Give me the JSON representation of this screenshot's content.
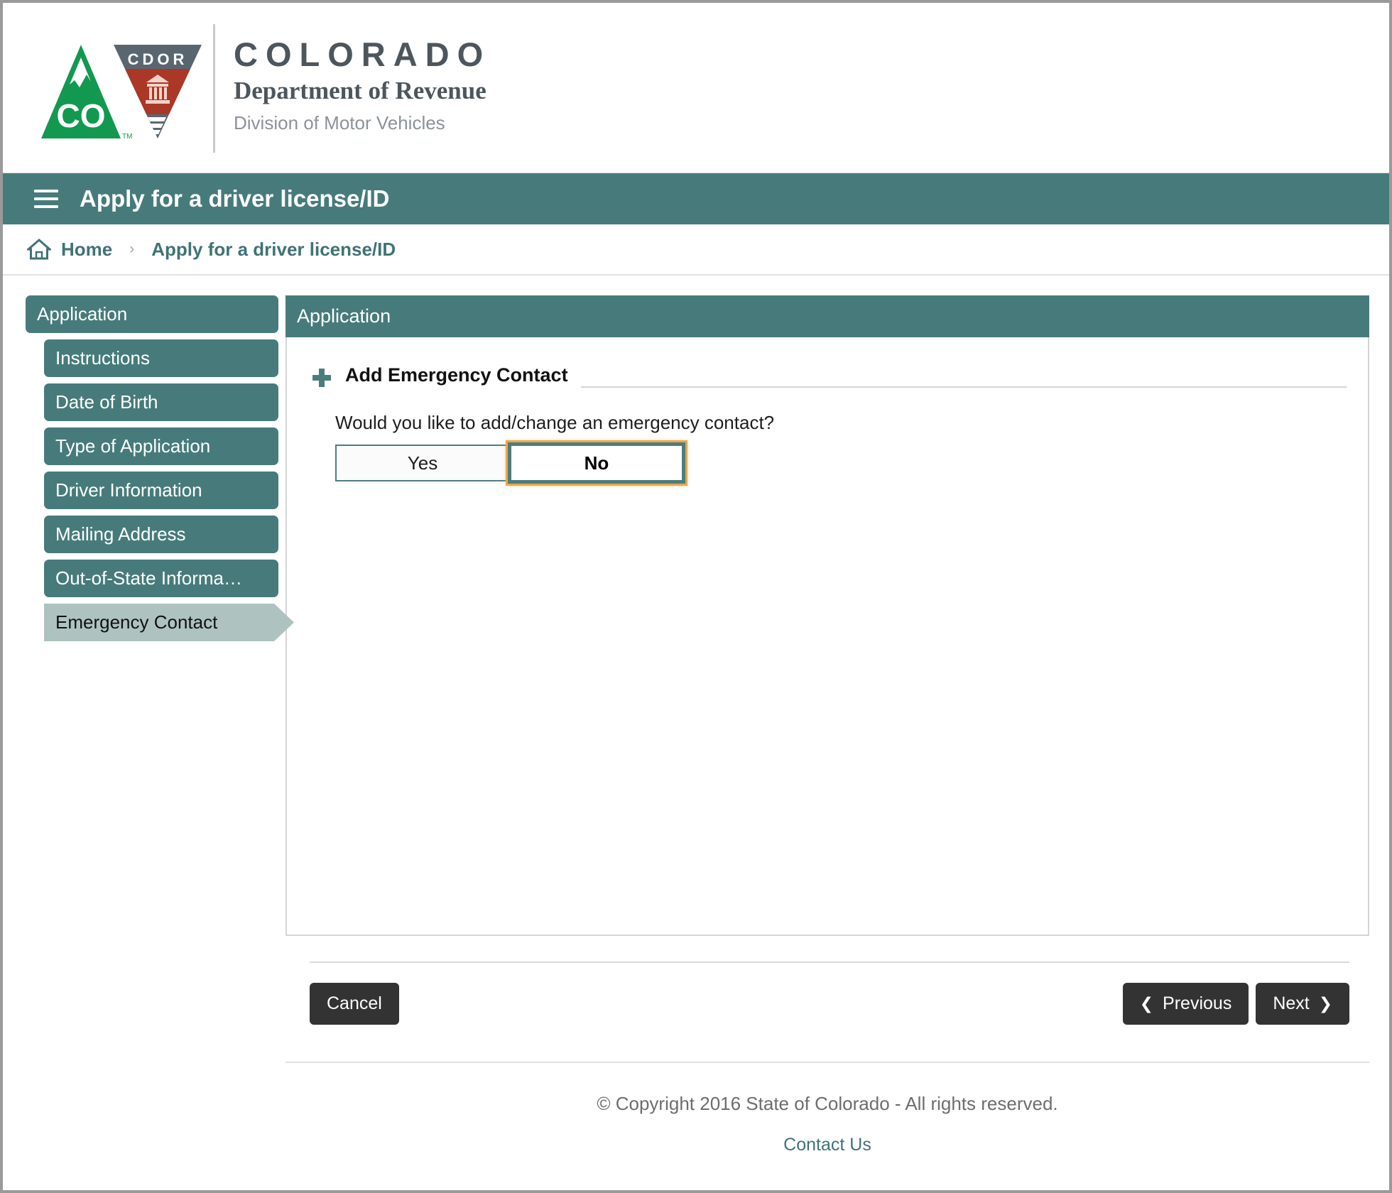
{
  "brand": {
    "logo_alt": "colorado-co-mountain-logo",
    "cdor_label": "CDOR",
    "state_name": "COLORADO",
    "department": "Department of Revenue",
    "division": "Division of Motor Vehicles"
  },
  "appbar": {
    "menu_icon": "hamburger-menu-icon",
    "title": "Apply for a driver license/ID"
  },
  "breadcrumb": {
    "home_icon": "home-icon",
    "home_label": "Home",
    "separator": "›",
    "current": "Apply for a driver license/ID"
  },
  "sidebar": {
    "group_label": "Application",
    "items": [
      {
        "label": "Instructions",
        "active": false
      },
      {
        "label": "Date of Birth",
        "active": false
      },
      {
        "label": "Type of Application",
        "active": false
      },
      {
        "label": "Driver Information",
        "active": false
      },
      {
        "label": "Mailing Address",
        "active": false
      },
      {
        "label": "Out-of-State Informa…",
        "active": false
      },
      {
        "label": "Emergency Contact",
        "active": true
      }
    ]
  },
  "panel": {
    "header": "Application",
    "section": {
      "icon": "plus-icon",
      "title": "Add Emergency Contact",
      "question": "Would you like to add/change an emergency contact?",
      "choices": {
        "yes_label": "Yes",
        "no_label": "No",
        "selected": "No"
      }
    }
  },
  "actions": {
    "cancel_label": "Cancel",
    "previous_label": "Previous",
    "next_label": "Next",
    "previous_icon": "chevron-left-icon",
    "next_icon": "chevron-right-icon"
  },
  "footer": {
    "copyright": "© Copyright 2016 State of Colorado - All rights reserved.",
    "contact_label": "Contact Us"
  },
  "colors": {
    "teal": "#477b7b",
    "teal_link": "#3f7377",
    "active_nav": "#aec3c0",
    "focus_orange": "#eda64a",
    "dark_button": "#333333",
    "logo_green": "#12994f",
    "logo_gray": "#596670",
    "logo_red": "#ab3726"
  }
}
